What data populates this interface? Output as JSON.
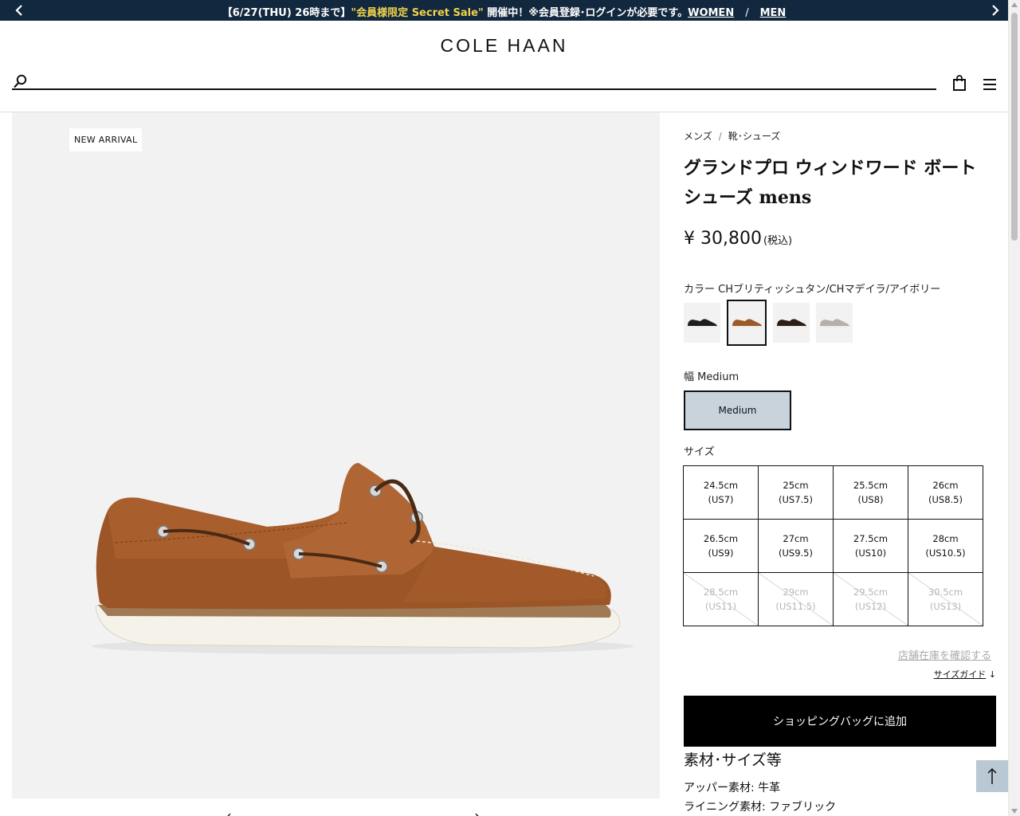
{
  "announcement": {
    "prefix": "【6/27(THU) 26時まで】",
    "highlight": "\"会員様限定 Secret Sale\"",
    "suffix": " 開催中！※会員登録･ログインが必要です。",
    "link_women": "WOMEN",
    "separator": "/",
    "link_men": "MEN"
  },
  "header": {
    "logo": "COLE HAAN",
    "search_placeholder": ""
  },
  "gallery": {
    "badge": "NEW ARRIVAL",
    "prev_arrow": "‹",
    "next_arrow": "›"
  },
  "breadcrumb": [
    "メンズ",
    "靴･シューズ"
  ],
  "breadcrumb_sep": "/",
  "product": {
    "title": "グランドプロ ウィンドワード ボートシューズ mens",
    "price": "¥ 30,800",
    "tax": "(税込)",
    "color_label": "カラー",
    "color_value": "CHブリティッシュタン/CHマデイラ/アイボリー",
    "swatches": [
      "black",
      "british-tan",
      "dark-brown",
      "grey"
    ],
    "swatch_colors": [
      "#1d1d1d",
      "#9a5a2a",
      "#2d1e17",
      "#b4b0aa"
    ],
    "selected_swatch": 1,
    "width_label": "幅",
    "width_value": "Medium",
    "width_button": "Medium",
    "size_label": "サイズ",
    "sizes": [
      {
        "cm": "24.5cm",
        "us": "(US7)",
        "available": true
      },
      {
        "cm": "25cm",
        "us": "(US7.5)",
        "available": true
      },
      {
        "cm": "25.5cm",
        "us": "(US8)",
        "available": true
      },
      {
        "cm": "26cm",
        "us": "(US8.5)",
        "available": true
      },
      {
        "cm": "26.5cm",
        "us": "(US9)",
        "available": true
      },
      {
        "cm": "27cm",
        "us": "(US9.5)",
        "available": true
      },
      {
        "cm": "27.5cm",
        "us": "(US10)",
        "available": true
      },
      {
        "cm": "28cm",
        "us": "(US10.5)",
        "available": true
      },
      {
        "cm": "28.5cm",
        "us": "(US11)",
        "available": false
      },
      {
        "cm": "29cm",
        "us": "(US11.5)",
        "available": false
      },
      {
        "cm": "29.5cm",
        "us": "(US12)",
        "available": false
      },
      {
        "cm": "30.5cm",
        "us": "(US13)",
        "available": false
      }
    ],
    "store_stock_link": "店舗在庫を確認する",
    "size_guide": "サイズガイド",
    "size_guide_arrow": "↓",
    "add_to_bag": "ショッピングバッグに追加",
    "spec_title": "素材･サイズ等",
    "specs": [
      "アッパー素材: 牛革",
      "ライニング素材: ファブリック"
    ]
  },
  "colors": {
    "announce_bg": "#12283e",
    "highlight": "#f2d34c",
    "width_selected_bg": "#c9d3dc",
    "totop_bg": "#b9c8d3"
  }
}
